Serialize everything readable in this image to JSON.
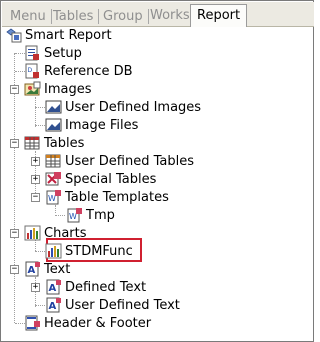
{
  "tabs": [
    {
      "label": "Menu"
    },
    {
      "label": "Tables"
    },
    {
      "label": "Group"
    },
    {
      "label": "Works"
    },
    {
      "label": "Report"
    }
  ],
  "tree": {
    "root": "Smart Report",
    "setup": "Setup",
    "reference_db": "Reference DB",
    "images": "Images",
    "user_defined_images": "User Defined Images",
    "image_files": "Image Files",
    "tables": "Tables",
    "user_defined_tables": "User Defined Tables",
    "special_tables": "Special Tables",
    "table_templates": "Table Templates",
    "tmp": "Tmp",
    "charts": "Charts",
    "stdmfunc": "STDMFunc",
    "text": "Text",
    "defined_text": "Defined Text",
    "user_defined_text": "User Defined Text",
    "header_footer": "Header & Footer"
  },
  "expander": {
    "minus": "−",
    "plus": "+"
  },
  "colors": {
    "selection_border": "#d02030",
    "tab_bar": "#eceae2"
  }
}
